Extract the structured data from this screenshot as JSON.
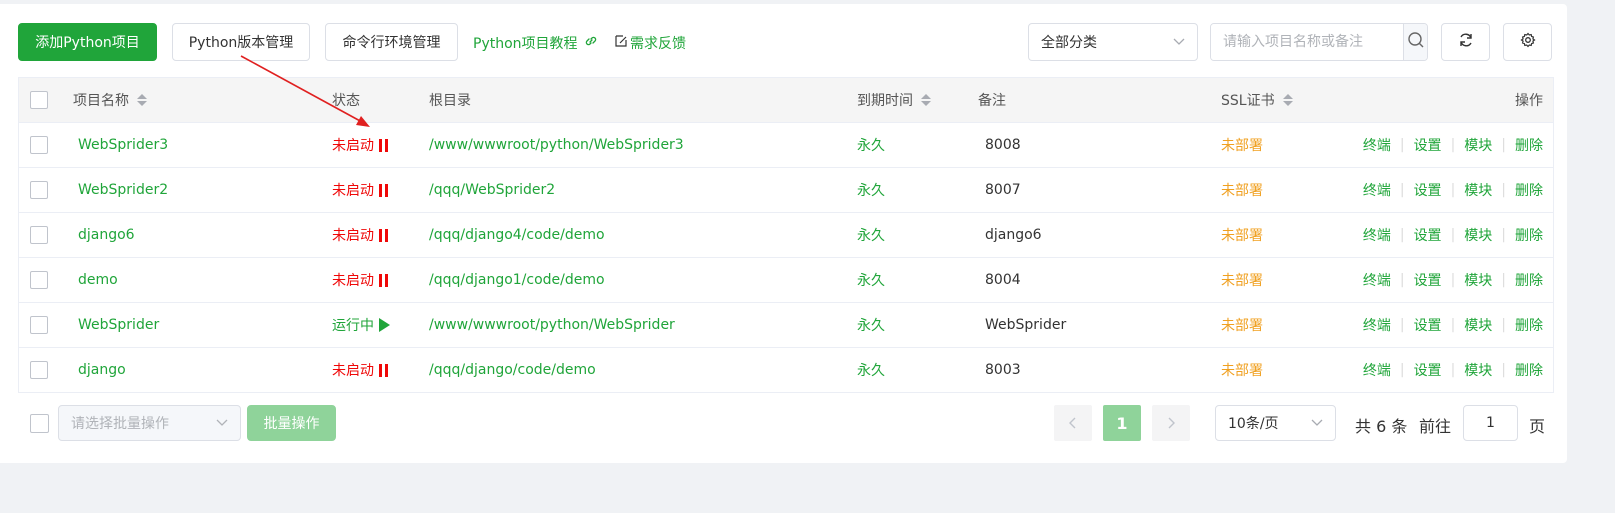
{
  "toolbar": {
    "add_project": "添加Python项目",
    "version_manage": "Python版本管理",
    "cli_env": "命令行环境管理",
    "tutorial": "Python项目教程",
    "feedback": "需求反馈",
    "category_select": "全部分类",
    "search_placeholder": "请输入项目名称或备注"
  },
  "table": {
    "headers": {
      "name": "项目名称",
      "status": "状态",
      "root": "根目录",
      "expire": "到期时间",
      "remark": "备注",
      "ssl": "SSL证书",
      "ops": "操作"
    },
    "rows": [
      {
        "name": "WebSprider3",
        "status": "未启动",
        "running": false,
        "root": "/www/wwwroot/python/WebSprider3",
        "expire": "永久",
        "remark": "8008",
        "ssl": "未部署"
      },
      {
        "name": "WebSprider2",
        "status": "未启动",
        "running": false,
        "root": "/qqq/WebSprider2",
        "expire": "永久",
        "remark": "8007",
        "ssl": "未部署"
      },
      {
        "name": "django6",
        "status": "未启动",
        "running": false,
        "root": "/qqq/django4/code/demo",
        "expire": "永久",
        "remark": "django6",
        "ssl": "未部署"
      },
      {
        "name": "demo",
        "status": "未启动",
        "running": false,
        "root": "/qqq/django1/code/demo",
        "expire": "永久",
        "remark": "8004",
        "ssl": "未部署"
      },
      {
        "name": "WebSprider",
        "status": "运行中",
        "running": true,
        "root": "/www/wwwroot/python/WebSprider",
        "expire": "永久",
        "remark": "WebSprider",
        "ssl": "未部署"
      },
      {
        "name": "django",
        "status": "未启动",
        "running": false,
        "root": "/qqq/django/code/demo",
        "expire": "永久",
        "remark": "8003",
        "ssl": "未部署"
      }
    ],
    "ops": [
      "终端",
      "设置",
      "模块",
      "删除"
    ]
  },
  "footer": {
    "batch_placeholder": "请选择批量操作",
    "batch_button": "批量操作",
    "current_page": "1",
    "page_size": "10条/页",
    "total": "共 6 条",
    "goto_label": "前往",
    "goto_value": "1",
    "page_suffix": "页"
  },
  "colors": {
    "primary": "#20a53a",
    "stopped": "#ef0808",
    "ssl_none": "#f0a020"
  },
  "icons": [
    "link-icon",
    "edit-icon",
    "chevron-down-icon",
    "search-icon",
    "refresh-icon",
    "gear-icon",
    "pause-icon",
    "play-icon",
    "chevron-left-icon",
    "chevron-right-icon"
  ]
}
